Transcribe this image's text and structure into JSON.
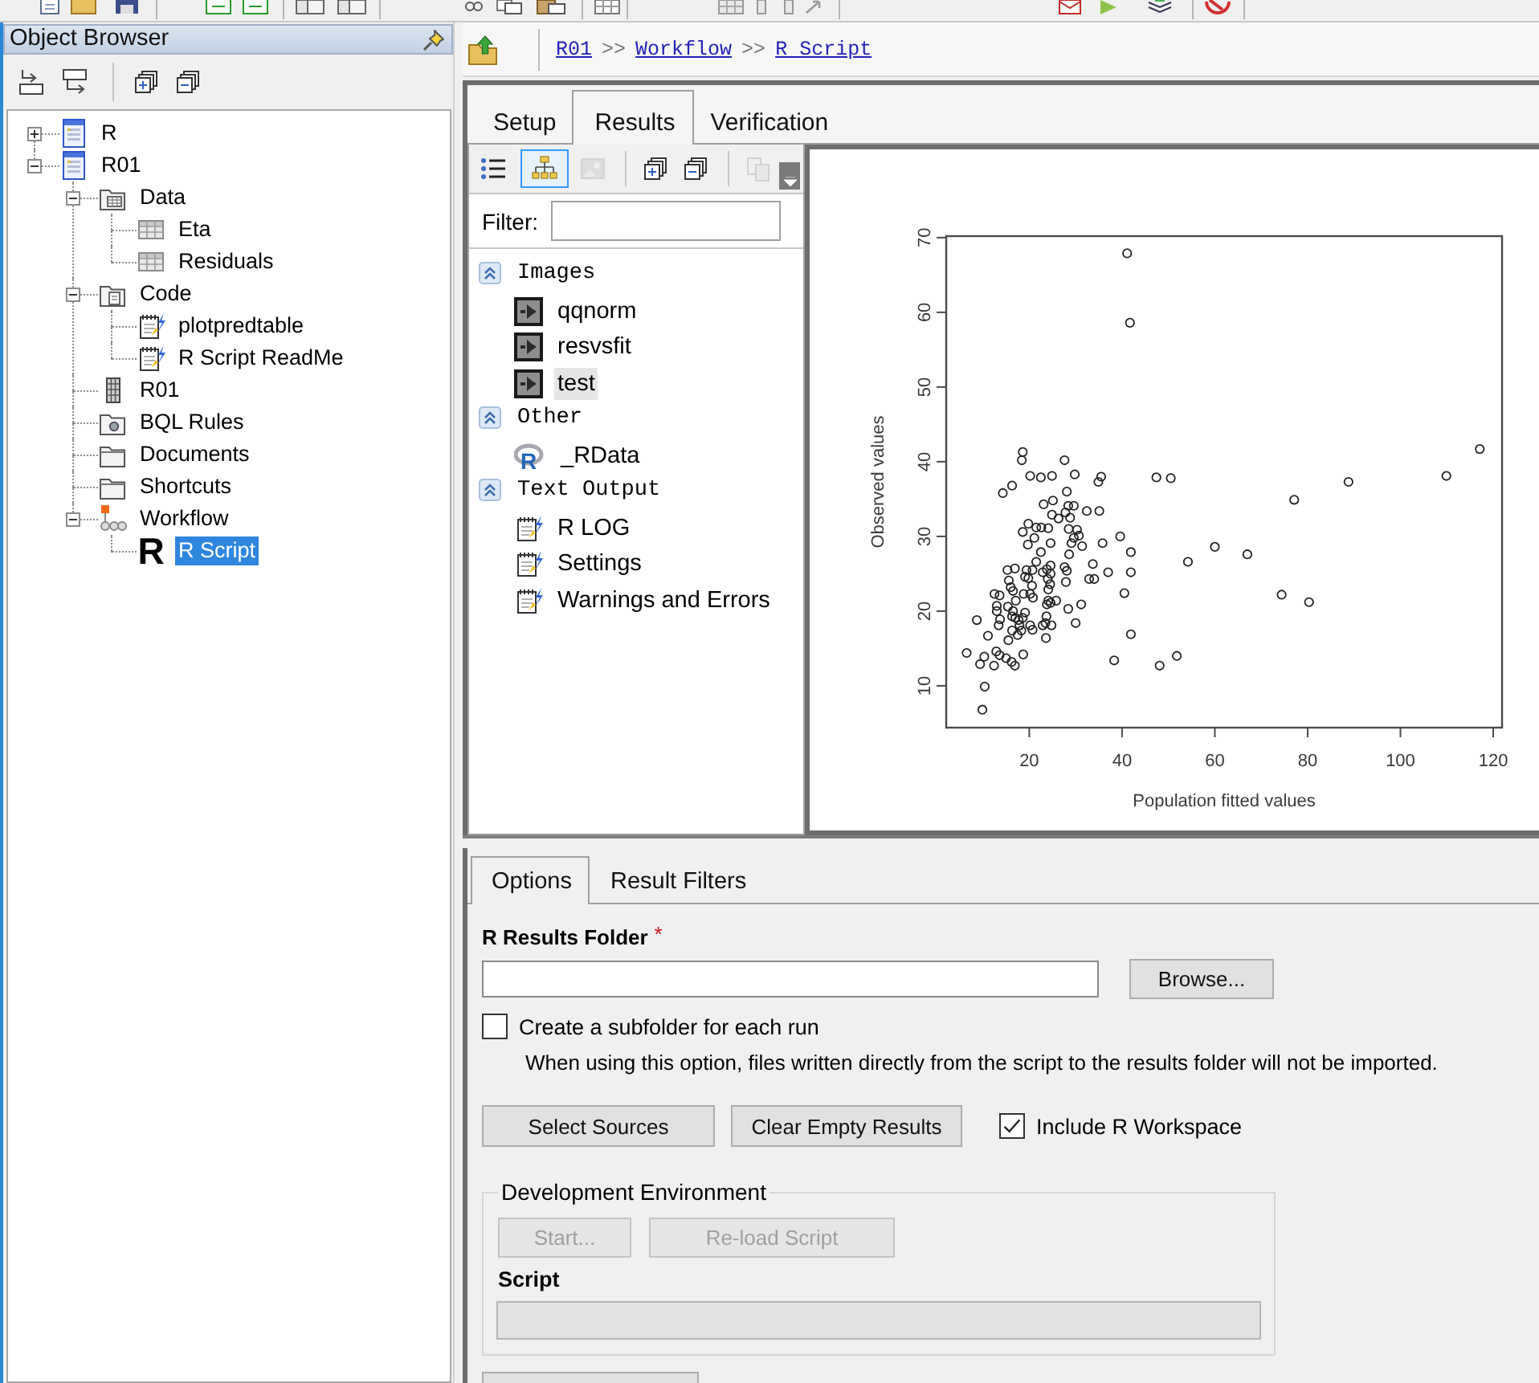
{
  "object_browser": {
    "title": "Object Browser",
    "tree": [
      {
        "label": "R",
        "kind": "project",
        "expanded": false,
        "selected": false
      },
      {
        "label": "R01",
        "kind": "project",
        "expanded": true,
        "selected": false,
        "children": [
          {
            "label": "Data",
            "kind": "datafolder",
            "expanded": true,
            "selected": false,
            "children": [
              {
                "label": "Eta",
                "kind": "table",
                "selected": false
              },
              {
                "label": "Residuals",
                "kind": "table",
                "selected": false
              }
            ]
          },
          {
            "label": "Code",
            "kind": "codefolder",
            "expanded": true,
            "selected": false,
            "children": [
              {
                "label": "plotpredtable",
                "kind": "script",
                "selected": false
              },
              {
                "label": "R Script ReadMe",
                "kind": "script",
                "selected": false
              }
            ]
          },
          {
            "label": "R01",
            "kind": "matrix",
            "selected": false
          },
          {
            "label": "BQL Rules",
            "kind": "rulesfolder",
            "selected": false
          },
          {
            "label": "Documents",
            "kind": "folder",
            "selected": false
          },
          {
            "label": "Shortcuts",
            "kind": "folder",
            "selected": false
          },
          {
            "label": "Workflow",
            "kind": "workflow",
            "expanded": true,
            "selected": false,
            "children": [
              {
                "label": "R Script",
                "kind": "rscript",
                "glyph": "R",
                "selected": true
              }
            ]
          }
        ]
      }
    ]
  },
  "breadcrumb": [
    {
      "kind": "link",
      "text": "R01"
    },
    {
      "kind": "separator",
      "text": ">>"
    },
    {
      "kind": "link",
      "text": "Workflow"
    },
    {
      "kind": "separator",
      "text": ">>"
    },
    {
      "kind": "link",
      "text": "R Script"
    }
  ],
  "tabs": [
    {
      "label": "Setup",
      "selected": false
    },
    {
      "label": "Results",
      "selected": true
    },
    {
      "label": "Verification",
      "selected": false
    }
  ],
  "results": {
    "toolbar": [
      {
        "kind": "list",
        "selected": false,
        "disabled": false
      },
      {
        "kind": "tree",
        "selected": true,
        "disabled": false
      },
      {
        "kind": "image",
        "selected": false,
        "disabled": true
      },
      {
        "kind": "expand",
        "selected": false,
        "disabled": false
      },
      {
        "kind": "collapse",
        "selected": false,
        "disabled": false
      },
      {
        "kind": "copy",
        "selected": false,
        "disabled": true
      }
    ],
    "filter": {
      "label": "Filter:"
    },
    "groups": [
      {
        "title": "Images",
        "expanded": true,
        "items": [
          {
            "label": "qqnorm",
            "kind": "image",
            "selected": false
          },
          {
            "label": "resvsfit",
            "kind": "image",
            "selected": false
          },
          {
            "label": "test",
            "kind": "image",
            "selected": true
          }
        ]
      },
      {
        "title": "Other",
        "expanded": true,
        "items": [
          {
            "label": "_RData",
            "kind": "rdata",
            "glyph": "R",
            "selected": false
          }
        ]
      },
      {
        "title": "Text Output",
        "expanded": true,
        "items": [
          {
            "label": "R LOG",
            "kind": "script",
            "selected": false
          },
          {
            "label": "Settings",
            "kind": "script",
            "selected": false
          },
          {
            "label": "Warnings and Errors",
            "kind": "script",
            "selected": false
          }
        ]
      }
    ]
  },
  "viewer": {
    "chart_data": {
      "type": "scatter",
      "xlabel": "Population fitted values",
      "ylabel": "Observed values",
      "x": [
        41.1,
        41.7,
        117.1,
        109.9,
        88.8,
        77.1,
        60.0,
        67.0,
        54.2,
        74.4,
        80.3,
        51.8,
        48.1,
        38.3,
        47.4,
        50.5,
        41.9,
        41.9,
        41.9,
        40.5,
        39.6,
        37.0,
        35.8,
        33.7,
        32.9,
        34.0,
        35.1,
        32.4,
        35.5,
        34.9,
        29.8,
        27.6,
        28.1,
        24.9,
        22.5,
        20.2,
        18.6,
        18.4,
        16.3,
        14.3,
        31.4,
        31.2,
        30.0,
        28.4,
        27.9,
        28.1,
        27.6,
        28.6,
        29.1,
        29.6,
        28.5,
        30.3,
        30.7,
        28.8,
        27.8,
        29.6,
        28.4,
        25.1,
        23.1,
        26.3,
        24.9,
        24.1,
        22.6,
        21.5,
        19.8,
        18.6,
        19.7,
        21.1,
        24.6,
        22.5,
        21.5,
        20.7,
        19.4,
        19.8,
        20.6,
        20.2,
        20.8,
        18.8,
        19.1,
        16.9,
        15.3,
        15.6,
        16.0,
        16.5,
        17.1,
        16.5,
        15.4,
        13.6,
        12.5,
        13.0,
        13.0,
        13.7,
        13.4,
        16.3,
        17.0,
        17.7,
        18.6,
        19.1,
        17.9,
        16.3,
        18.3,
        17.5,
        20.2,
        20.7,
        15.5,
        18.7,
        23.5,
        23.6,
        22.9,
        24.8,
        23.7,
        23.8,
        24.1,
        24.6,
        25.8,
        24.1,
        24.5,
        24.6,
        23.8,
        24.6,
        22.9,
        24.0,
        12.9,
        13.6,
        15.0,
        16.2,
        16.9,
        12.4,
        11.1,
        10.3,
        9.4,
        10.4,
        9.9,
        6.5,
        8.7
      ],
      "values": [
        67.9,
        58.6,
        41.7,
        38.1,
        37.3,
        34.9,
        28.6,
        27.6,
        26.6,
        22.2,
        21.2,
        14.0,
        12.7,
        13.4,
        37.9,
        37.8,
        27.9,
        25.2,
        16.9,
        22.4,
        30.0,
        25.2,
        29.1,
        26.3,
        24.3,
        24.3,
        33.4,
        33.4,
        38.0,
        37.3,
        38.3,
        40.2,
        36.0,
        38.1,
        37.9,
        38.1,
        41.3,
        40.2,
        36.8,
        35.8,
        28.7,
        20.9,
        18.4,
        20.3,
        23.9,
        25.4,
        25.9,
        27.6,
        29.1,
        29.8,
        31.0,
        30.9,
        30.1,
        32.5,
        33.2,
        34.1,
        34.1,
        34.8,
        34.3,
        32.4,
        32.9,
        31.1,
        31.2,
        31.2,
        31.7,
        30.6,
        28.9,
        29.8,
        29.1,
        27.9,
        26.6,
        25.5,
        25.5,
        24.4,
        23.4,
        22.3,
        21.8,
        22.3,
        24.6,
        25.7,
        25.5,
        24.1,
        23.2,
        22.7,
        21.4,
        20.0,
        20.6,
        22.1,
        22.3,
        20.7,
        20.0,
        18.9,
        18.1,
        19.3,
        19.1,
        18.8,
        19.1,
        19.8,
        18.1,
        17.4,
        17.4,
        16.8,
        18.1,
        17.5,
        16.1,
        14.2,
        18.4,
        16.4,
        18.1,
        18.1,
        19.3,
        20.9,
        21.4,
        21.1,
        21.4,
        22.9,
        23.6,
        25.0,
        25.6,
        26.1,
        25.2,
        24.3,
        14.6,
        14.1,
        13.7,
        13.2,
        12.7,
        12.7,
        16.7,
        13.9,
        12.9,
        9.9,
        6.8,
        14.4,
        18.8
      ],
      "xlim": [
        2.1,
        121.9
      ],
      "ylim": [
        4.4,
        70.2
      ],
      "xticks": [
        20,
        40,
        60,
        80,
        100,
        120
      ],
      "yticks": [
        10,
        20,
        30,
        40,
        50,
        60,
        70
      ]
    }
  },
  "options": {
    "tabs": [
      {
        "label": "Options",
        "selected": true
      },
      {
        "label": "Result Filters",
        "selected": false
      }
    ],
    "results_folder": {
      "label": "R Results Folder",
      "required_mark": "*",
      "browse_button": "Browse..."
    },
    "subfolder": {
      "label": "Create a subfolder for each run",
      "checked": false,
      "note": "When using this option, files written directly from the script to the results folder will not be imported."
    },
    "buttons": [
      "Select Sources",
      "Clear Empty Results"
    ],
    "workspace": {
      "label": "Include R Workspace",
      "checked": true
    },
    "dev_environment": {
      "title": "Development Environment",
      "buttons": [
        {
          "label": "Start...",
          "disabled": true
        },
        {
          "label": "Re-load Script",
          "disabled": true
        }
      ],
      "script": {
        "label": "Script",
        "disabled": true
      }
    }
  }
}
